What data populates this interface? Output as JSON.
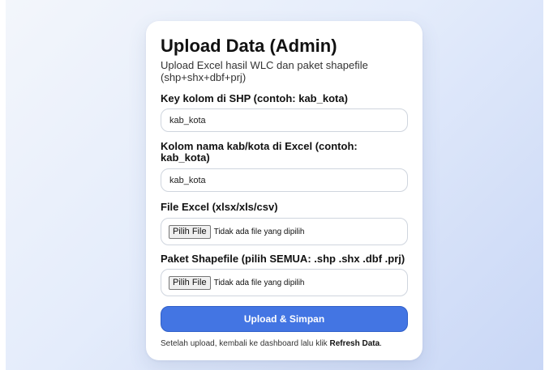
{
  "form": {
    "title": "Upload Data (Admin)",
    "subtitle": "Upload Excel hasil WLC dan paket shapefile (shp+shx+dbf+prj)",
    "shp_key": {
      "label": "Key kolom di SHP (contoh: kab_kota)",
      "value": "kab_kota"
    },
    "excel_key": {
      "label": "Kolom nama kab/kota di Excel (contoh: kab_kota)",
      "value": "kab_kota"
    },
    "excel_file": {
      "label": "File Excel (xlsx/xls/csv)",
      "button_label": "Pilih File",
      "status": "Tidak ada file yang dipilih"
    },
    "shapefile": {
      "label": "Paket Shapefile (pilih SEMUA: .shp .shx .dbf .prj)",
      "button_label": "Pilih File",
      "status": "Tidak ada file yang dipilih"
    },
    "submit_label": "Upload & Simpan",
    "footnote": {
      "prefix": "Setelah upload, kembali ke dashboard lalu klik ",
      "emphasis": "Refresh Data",
      "suffix": "."
    }
  },
  "colors": {
    "accent": "#4375e3",
    "background_start": "#f3f6fb",
    "background_end": "#c9d7f6"
  }
}
